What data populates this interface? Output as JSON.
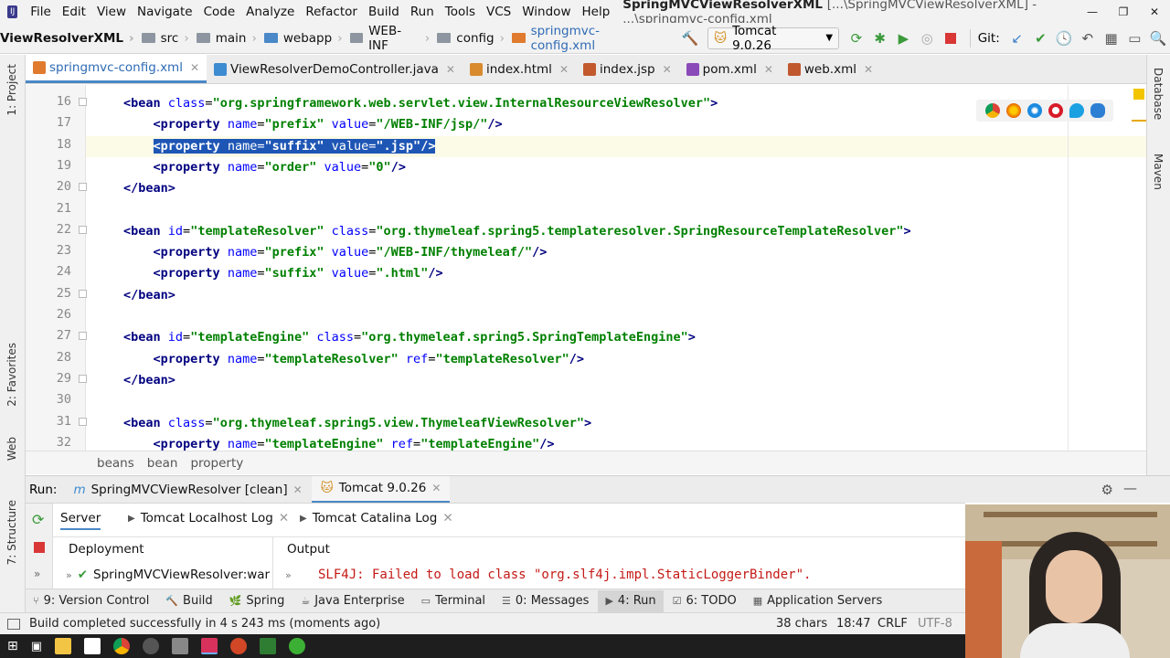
{
  "menubar": {
    "items": [
      "File",
      "Edit",
      "View",
      "Navigate",
      "Code",
      "Analyze",
      "Refactor",
      "Build",
      "Run",
      "Tools",
      "VCS",
      "Window",
      "Help"
    ],
    "window_title_bold": "SpringMVCViewResolverXML",
    "window_title_rest": "[...\\SpringMVCViewResolverXML] - ...\\springmvc-config.xml"
  },
  "navbar": {
    "crumbs": [
      "ViewResolverXML",
      "src",
      "main",
      "webapp",
      "WEB-INF",
      "config",
      "springmvc-config.xml"
    ],
    "run_config": "Tomcat 9.0.26",
    "git_label": "Git:"
  },
  "tabs": [
    {
      "label": "springmvc-config.xml",
      "icon_color": "#e07a2e",
      "active": true
    },
    {
      "label": "ViewResolverDemoController.java",
      "icon_color": "#3d8bd1",
      "active": false
    },
    {
      "label": "index.html",
      "icon_color": "#d98a2e",
      "active": false
    },
    {
      "label": "index.jsp",
      "icon_color": "#c25a2e",
      "active": false
    },
    {
      "label": "pom.xml",
      "icon_color": "#8a4ab8",
      "active": false
    },
    {
      "label": "web.xml",
      "icon_color": "#c0582e",
      "active": false
    }
  ],
  "left_strip": {
    "project": "1: Project",
    "favorites": "2: Favorites",
    "web": "Web",
    "structure": "7: Structure"
  },
  "right_strip": {
    "database": "Database",
    "maven": "Maven"
  },
  "editor": {
    "line_numbers": [
      "16",
      "17",
      "18",
      "19",
      "20",
      "21",
      "22",
      "23",
      "24",
      "25",
      "26",
      "27",
      "28",
      "29",
      "30",
      "31",
      "32"
    ],
    "lines": [
      "<bean class=\"org.springframework.web.servlet.view.InternalResourceViewResolver\">",
      "    <property name=\"prefix\" value=\"/WEB-INF/jsp/\"/>",
      "    <property name=\"suffix\" value=\".jsp\"/>",
      "    <property name=\"order\" value=\"0\"/>",
      "</bean>",
      "",
      "<bean id=\"templateResolver\" class=\"org.thymeleaf.spring5.templateresolver.SpringResourceTemplateResolver\">",
      "    <property name=\"prefix\" value=\"/WEB-INF/thymeleaf/\"/>",
      "    <property name=\"suffix\" value=\".html\"/>",
      "</bean>",
      "",
      "<bean id=\"templateEngine\" class=\"org.thymeleaf.spring5.SpringTemplateEngine\">",
      "    <property name=\"templateResolver\" ref=\"templateResolver\"/>",
      "</bean>",
      "",
      "<bean class=\"org.thymeleaf.spring5.view.ThymeleafViewResolver\">",
      "    <property name=\"templateEngine\" ref=\"templateEngine\"/>"
    ],
    "selected_line_index": 2
  },
  "xml_breadcrumbs": [
    "beans",
    "bean",
    "property"
  ],
  "run_panel": {
    "run_label": "Run:",
    "tabs": [
      {
        "label": "SpringMVCViewResolver [clean]",
        "active": false
      },
      {
        "label": "Tomcat 9.0.26",
        "active": true
      }
    ],
    "subtabs": [
      "Server",
      "Tomcat Localhost Log",
      "Tomcat Catalina Log"
    ],
    "deployment_label": "Deployment",
    "output_label": "Output",
    "deployment_item": "SpringMVCViewResolver:war",
    "console_text": "SLF4J: Failed to load class \"org.slf4j.impl.StaticLoggerBinder\"."
  },
  "bottom_tabs": [
    {
      "label": "9: Version Control",
      "active": false
    },
    {
      "label": "Build",
      "active": false
    },
    {
      "label": "Spring",
      "active": false
    },
    {
      "label": "Java Enterprise",
      "active": false
    },
    {
      "label": "Terminal",
      "active": false
    },
    {
      "label": "0: Messages",
      "active": false
    },
    {
      "label": "4: Run",
      "active": true
    },
    {
      "label": "6: TODO",
      "active": false
    },
    {
      "label": "Application Servers",
      "active": false
    }
  ],
  "statusbar": {
    "message": "Build completed successfully in 4 s 243 ms (moments ago)",
    "chars": "38 chars",
    "position": "18:47",
    "line_sep": "CRLF",
    "encoding": "UTF-8"
  },
  "colors": {
    "accent": "#4a88c7",
    "selection": "#1e56b5",
    "tag": "#000080",
    "attr": "#0000ff",
    "value": "#008000"
  }
}
